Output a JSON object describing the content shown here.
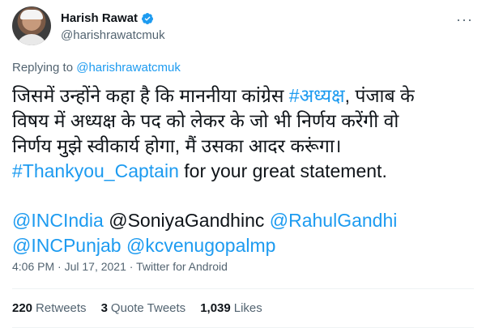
{
  "author": {
    "name": "Harish Rawat",
    "handle": "@harishrawatcmuk"
  },
  "reply": {
    "prefix": "Replying to ",
    "target": "@harishrawatcmuk"
  },
  "tweet": {
    "line1_a": "जिसमें उन्होंने कहा है कि माननीया कांग्रेस ",
    "line1_hashtag": "#अध्यक्ष",
    "line1_b": ", पंजाब के",
    "line2": "विषय में अध्यक्ष के पद को लेकर के जो भी निर्णय करेंगी वो",
    "line3": "निर्णय मुझे स्वीकार्य होगा, मैं उसका आदर करूंगा।",
    "hashtag_thankyou": "#Thankyou_Captain",
    "statement": " for your great statement.",
    "mention_inc": "@INCIndia",
    "mention_soniya": " @SoniyaGandhinc ",
    "mention_rahul": "@RahulGandhi",
    "mention_incpunjab": "@INCPunjab",
    "mention_kcv": "@kcvenugopalmp"
  },
  "meta": {
    "time": "4:06 PM",
    "sep1": " · ",
    "date": "Jul 17, 2021",
    "sep2": " · ",
    "source": "Twitter for Android"
  },
  "stats": {
    "retweets_count": "220",
    "retweets_label": "Retweets",
    "quotes_count": "3",
    "quotes_label": "Quote Tweets",
    "likes_count": "1,039",
    "likes_label": "Likes"
  },
  "colors": {
    "link": "#1d9bf0",
    "text": "#0f1419",
    "muted": "#536471"
  }
}
